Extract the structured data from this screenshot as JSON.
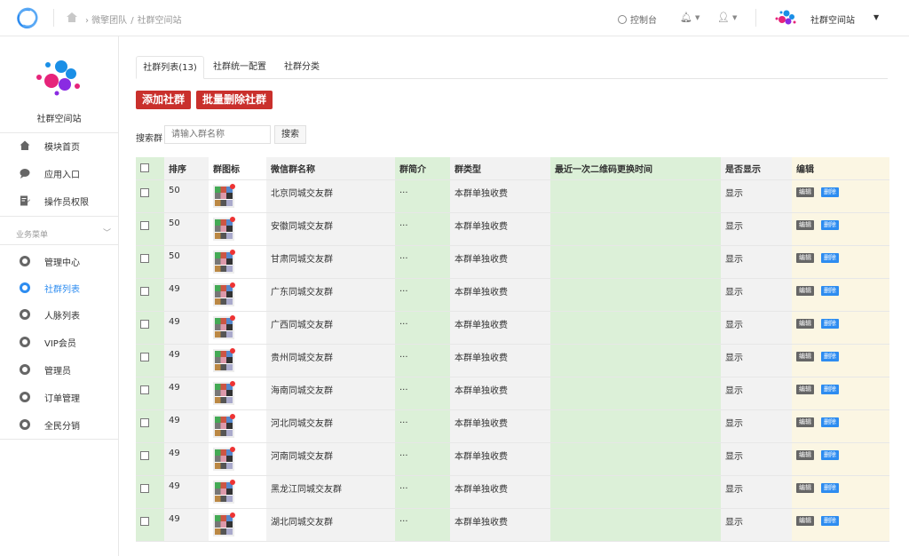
{
  "header": {
    "breadcrumb": [
      "微擎团队",
      "社群空间站"
    ],
    "breadcrumb_sep": "/",
    "console": "控制台",
    "site_name": "社群空间站"
  },
  "sidebar": {
    "site_name": "社群空间站",
    "top_items": [
      {
        "label": "模块首页",
        "icon": "home-icon"
      },
      {
        "label": "应用入口",
        "icon": "chat-icon"
      },
      {
        "label": "操作员权限",
        "icon": "edit-doc-icon"
      }
    ],
    "group_label": "业务菜单",
    "items": [
      {
        "label": "管理中心",
        "icon": "gear-icon",
        "active": false
      },
      {
        "label": "社群列表",
        "icon": "gear-icon",
        "active": true
      },
      {
        "label": "人脉列表",
        "icon": "gear-icon",
        "active": false
      },
      {
        "label": "VIP会员",
        "icon": "gear-icon",
        "active": false
      },
      {
        "label": "管理员",
        "icon": "gear-icon",
        "active": false
      },
      {
        "label": "订单管理",
        "icon": "gear-icon",
        "active": false
      },
      {
        "label": "全民分销",
        "icon": "gear-icon",
        "active": false
      }
    ]
  },
  "tabs": [
    {
      "label": "社群列表(13)",
      "active": true
    },
    {
      "label": "社群统一配置",
      "active": false
    },
    {
      "label": "社群分类",
      "active": false
    }
  ],
  "actions": {
    "add": "添加社群",
    "batch_delete": "批量删除社群"
  },
  "search": {
    "label": "搜索群",
    "placeholder": "请输入群名称",
    "button": "搜索"
  },
  "table": {
    "columns": [
      "排序",
      "群图标",
      "微信群名称",
      "群简介",
      "群类型",
      "最近一次二维码更换时间",
      "是否显示",
      "编辑"
    ],
    "edit_label": "编辑",
    "delete_label": "删除",
    "rows": [
      {
        "sort": "50",
        "name": "北京同城交友群",
        "intro": "...",
        "type": "本群单独收费",
        "last_qr": "",
        "show": "显示"
      },
      {
        "sort": "50",
        "name": "安徽同城交友群",
        "intro": "...",
        "type": "本群单独收费",
        "last_qr": "",
        "show": "显示"
      },
      {
        "sort": "50",
        "name": "甘肃同城交友群",
        "intro": "...",
        "type": "本群单独收费",
        "last_qr": "",
        "show": "显示"
      },
      {
        "sort": "49",
        "name": "广东同城交友群",
        "intro": "...",
        "type": "本群单独收费",
        "last_qr": "",
        "show": "显示"
      },
      {
        "sort": "49",
        "name": "广西同城交友群",
        "intro": "...",
        "type": "本群单独收费",
        "last_qr": "",
        "show": "显示"
      },
      {
        "sort": "49",
        "name": "贵州同城交友群",
        "intro": "...",
        "type": "本群单独收费",
        "last_qr": "",
        "show": "显示"
      },
      {
        "sort": "49",
        "name": "海南同城交友群",
        "intro": "...",
        "type": "本群单独收费",
        "last_qr": "",
        "show": "显示"
      },
      {
        "sort": "49",
        "name": "河北同城交友群",
        "intro": "...",
        "type": "本群单独收费",
        "last_qr": "",
        "show": "显示"
      },
      {
        "sort": "49",
        "name": "河南同城交友群",
        "intro": "...",
        "type": "本群单独收费",
        "last_qr": "",
        "show": "显示"
      },
      {
        "sort": "49",
        "name": "黑龙江同城交友群",
        "intro": "...",
        "type": "本群单独收费",
        "last_qr": "",
        "show": "显示"
      },
      {
        "sort": "49",
        "name": "湖北同城交友群",
        "intro": "...",
        "type": "本群单独收费",
        "last_qr": "",
        "show": "显示"
      }
    ]
  },
  "colors": {
    "accent": "#2d8cf0",
    "danger": "#c9302c",
    "col_green": "#dcf0d8",
    "col_gray": "#f2f2f2",
    "col_yellow": "#fbf6e3"
  }
}
